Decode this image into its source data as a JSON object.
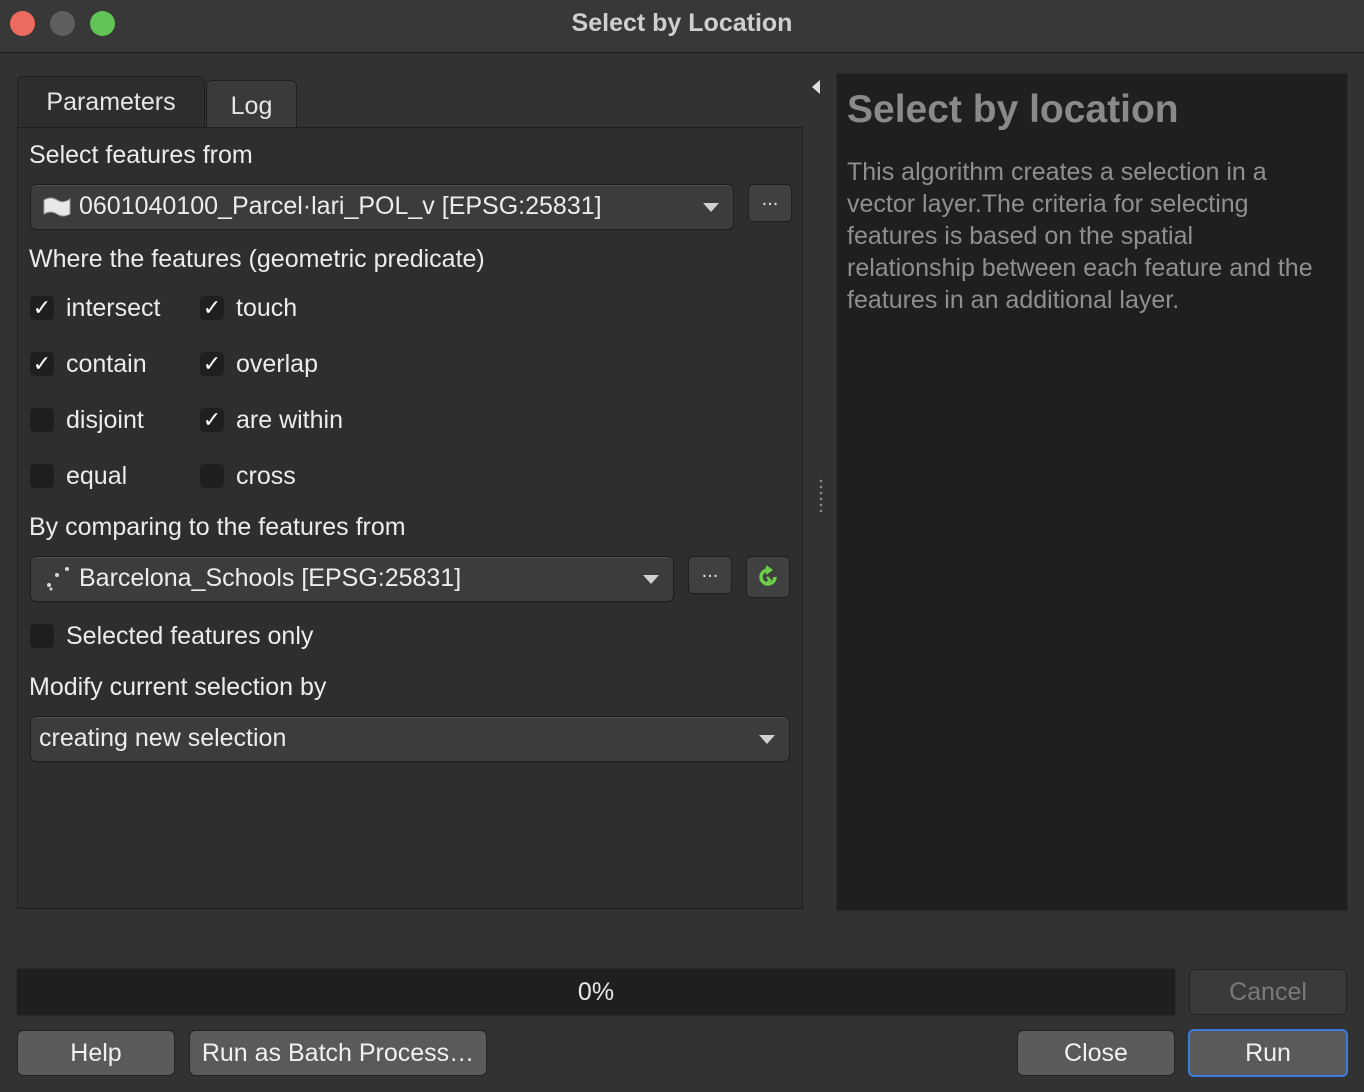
{
  "window": {
    "title": "Select by Location"
  },
  "tabs": [
    {
      "label": "Parameters"
    },
    {
      "label": "Log"
    }
  ],
  "params": {
    "input_label": "Select features from",
    "input_layer": "0601040100_Parcel·lari_POL_v [EPSG:25831]",
    "predicate_label": "Where the features (geometric predicate)",
    "predicates": [
      {
        "label": "intersect",
        "checked": true
      },
      {
        "label": "touch",
        "checked": true
      },
      {
        "label": "contain",
        "checked": true
      },
      {
        "label": "overlap",
        "checked": true
      },
      {
        "label": "disjoint",
        "checked": false
      },
      {
        "label": "are within",
        "checked": true
      },
      {
        "label": "equal",
        "checked": false
      },
      {
        "label": "cross",
        "checked": false
      }
    ],
    "intersect_label": "By comparing to the features from",
    "intersect_layer": "Barcelona_Schools [EPSG:25831]",
    "selected_only_label": "Selected features only",
    "selected_only_checked": false,
    "method_label": "Modify current selection by",
    "method_value": "creating new selection",
    "browse_label": "..."
  },
  "help": {
    "title": "Select by location",
    "text": "This algorithm creates a selection in a vector layer.The criteria for selecting features is based on the spatial relationship between each feature and the features in an additional layer."
  },
  "progress": {
    "value_text": "0%",
    "value": 0
  },
  "buttons": {
    "cancel": "Cancel",
    "help": "Help",
    "batch": "Run as Batch Process…",
    "close": "Close",
    "run": "Run"
  },
  "icons": {
    "polygon_layer": "polygon-layer-icon",
    "point_layer": "point-layer-icon",
    "iterate": "iterate-icon",
    "collapse": "collapse-arrow-icon"
  }
}
